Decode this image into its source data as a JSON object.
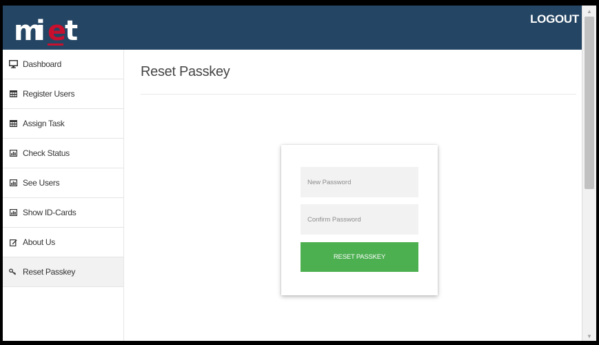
{
  "header": {
    "logo_text": "miet",
    "logout_label": "LOGOUT"
  },
  "colors": {
    "header_bg": "#244563",
    "logo_red": "#c8102e",
    "button_green": "#4caf50"
  },
  "sidebar": {
    "items": [
      {
        "label": "Dashboard",
        "icon": "desktop-icon"
      },
      {
        "label": "Register Users",
        "icon": "table-icon"
      },
      {
        "label": "Assign Task",
        "icon": "table-icon"
      },
      {
        "label": "Check Status",
        "icon": "chart-icon"
      },
      {
        "label": "See Users",
        "icon": "chart-icon"
      },
      {
        "label": "Show ID-Cards",
        "icon": "chart-icon"
      },
      {
        "label": "About Us",
        "icon": "edit-icon"
      },
      {
        "label": "Reset Passkey",
        "icon": "key-icon",
        "active": true
      }
    ]
  },
  "main": {
    "title": "Reset Passkey",
    "form": {
      "new_password_placeholder": "New Password",
      "confirm_password_placeholder": "Confirm Password",
      "submit_label": "RESET PASSKEY"
    }
  }
}
